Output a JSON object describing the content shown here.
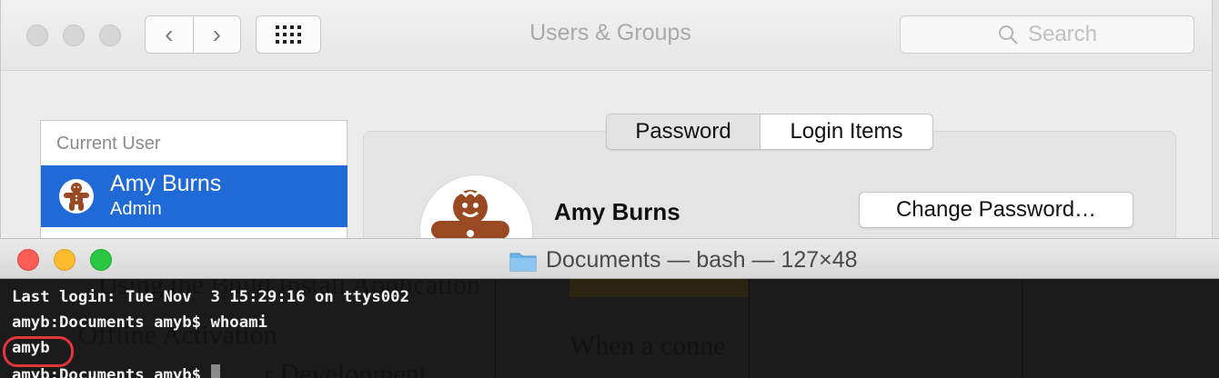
{
  "prefs_window": {
    "title": "Users & Groups",
    "search_placeholder": "Search",
    "nav": {
      "back_glyph": "‹",
      "forward_glyph": "›"
    },
    "sidebar": {
      "header": "Current User",
      "selected_user": {
        "name": "Amy Burns",
        "role": "Admin",
        "avatar_icon": "gingerbread-man-icon"
      }
    },
    "tabs": [
      {
        "label": "Password",
        "selected": true
      },
      {
        "label": "Login Items",
        "selected": false
      }
    ],
    "detail": {
      "user_name": "Amy Burns",
      "change_password_label": "Change Password…"
    },
    "colors": {
      "selection": "#1f6ad6"
    }
  },
  "terminal": {
    "title": "Documents — bash — 127×48",
    "folder_icon": "folder-icon",
    "lines": [
      "Last login: Tue Nov  3 15:29:16 on ttys002",
      "amyb:Documents amyb$ whoami",
      "amyb",
      "amyb:Documents amyb$ "
    ],
    "highlight_color": "#e0353a",
    "background_text": [
      "Using the Build Install Application",
      "Offline Activation",
      "When a conne",
      "r Development"
    ]
  }
}
